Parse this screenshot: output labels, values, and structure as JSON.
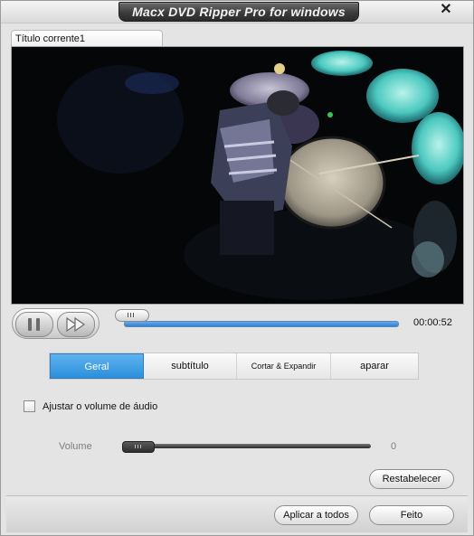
{
  "window": {
    "title": "Macx DVD Ripper Pro for windows",
    "close_glyph": "✕"
  },
  "tab": {
    "label": "Título corrente1"
  },
  "player": {
    "time": "00:00:52",
    "seek_fraction": 0.03
  },
  "tabs": [
    {
      "label": "Geral",
      "active": true
    },
    {
      "label": "subtítulo",
      "active": false
    },
    {
      "label": "Cortar & Expandir",
      "active": false
    },
    {
      "label": "aparar",
      "active": false
    }
  ],
  "audio": {
    "checkbox_label": "Ajustar o volume de áudio",
    "checked": false,
    "volume_label": "Volume",
    "volume_value": "0"
  },
  "buttons": {
    "reset": "Restabelecer",
    "apply_all": "Aplicar a todos",
    "done": "Feito"
  },
  "colors": {
    "accent": "#2b8fdc",
    "title_bar": "#3c3c3c"
  }
}
